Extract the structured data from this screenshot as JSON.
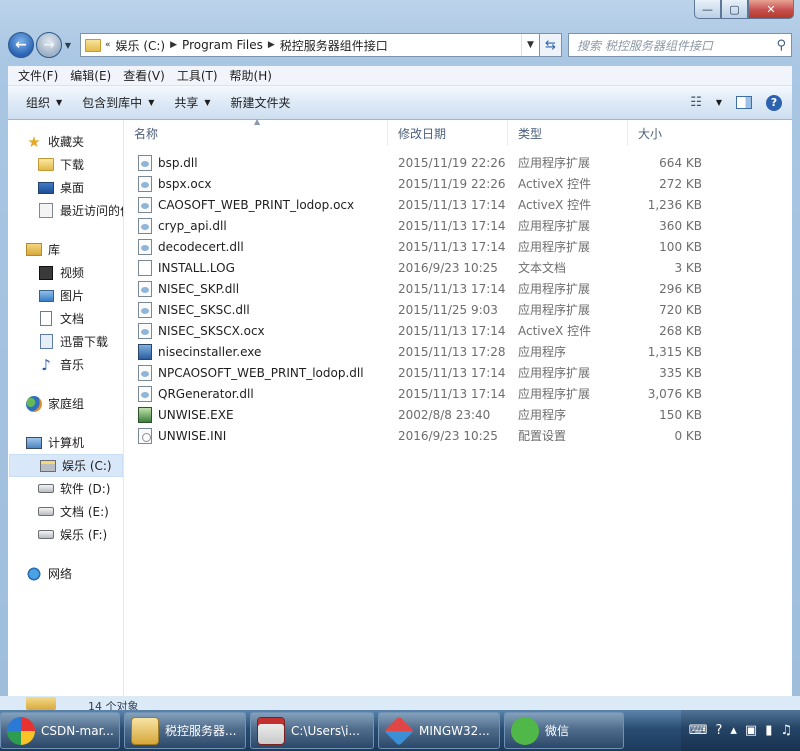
{
  "window": {
    "caption_buttons": [
      "—",
      "▢",
      "✕"
    ]
  },
  "address": {
    "overflow": "«",
    "crumbs": [
      "娱乐 (C:)",
      "Program Files",
      "税控服务器组件接口"
    ],
    "search_placeholder": "搜索 税控服务器组件接口"
  },
  "menubar": [
    "文件(F)",
    "编辑(E)",
    "查看(V)",
    "工具(T)",
    "帮助(H)"
  ],
  "commandbar": {
    "organize": "组织",
    "include_library": "包含到库中",
    "share": "共享",
    "new_folder": "新建文件夹"
  },
  "navpane": {
    "favorites": {
      "label": "收藏夹",
      "items": [
        "下载",
        "桌面",
        "最近访问的位置"
      ]
    },
    "libraries": {
      "label": "库",
      "items": [
        "视频",
        "图片",
        "文档",
        "迅雷下载",
        "音乐"
      ]
    },
    "homegroup": "家庭组",
    "computer": {
      "label": "计算机",
      "items": [
        "娱乐 (C:)",
        "软件 (D:)",
        "文档 (E:)",
        "娱乐 (F:)"
      ]
    },
    "network": "网络"
  },
  "columns": {
    "name": "名称",
    "date": "修改日期",
    "type": "类型",
    "size": "大小"
  },
  "files": [
    {
      "name": "bsp.dll",
      "date": "2015/11/19 22:26",
      "type": "应用程序扩展",
      "size": "664 KB",
      "icon": "dll-icon"
    },
    {
      "name": "bspx.ocx",
      "date": "2015/11/19 22:26",
      "type": "ActiveX 控件",
      "size": "272 KB",
      "icon": "ocx-icon"
    },
    {
      "name": "CAOSOFT_WEB_PRINT_lodop.ocx",
      "date": "2015/11/13 17:14",
      "type": "ActiveX 控件",
      "size": "1,236 KB",
      "icon": "ocx-icon"
    },
    {
      "name": "cryp_api.dll",
      "date": "2015/11/13 17:14",
      "type": "应用程序扩展",
      "size": "360 KB",
      "icon": "dll-icon"
    },
    {
      "name": "decodecert.dll",
      "date": "2015/11/13 17:14",
      "type": "应用程序扩展",
      "size": "100 KB",
      "icon": "dll-icon"
    },
    {
      "name": "INSTALL.LOG",
      "date": "2016/9/23 10:25",
      "type": "文本文档",
      "size": "3 KB",
      "icon": "text-file-icon"
    },
    {
      "name": "NISEC_SKP.dll",
      "date": "2015/11/13 17:14",
      "type": "应用程序扩展",
      "size": "296 KB",
      "icon": "dll-icon"
    },
    {
      "name": "NISEC_SKSC.dll",
      "date": "2015/11/25 9:03",
      "type": "应用程序扩展",
      "size": "720 KB",
      "icon": "dll-icon"
    },
    {
      "name": "NISEC_SKSCX.ocx",
      "date": "2015/11/13 17:14",
      "type": "ActiveX 控件",
      "size": "268 KB",
      "icon": "ocx-icon"
    },
    {
      "name": "nisecinstaller.exe",
      "date": "2015/11/13 17:28",
      "type": "应用程序",
      "size": "1,315 KB",
      "icon": "exe-icon"
    },
    {
      "name": "NPCAOSOFT_WEB_PRINT_lodop.dll",
      "date": "2015/11/13 17:14",
      "type": "应用程序扩展",
      "size": "335 KB",
      "icon": "dll-icon"
    },
    {
      "name": "QRGenerator.dll",
      "date": "2015/11/13 17:14",
      "type": "应用程序扩展",
      "size": "3,076 KB",
      "icon": "dll-icon"
    },
    {
      "name": "UNWISE.EXE",
      "date": "2002/8/8 23:40",
      "type": "应用程序",
      "size": "150 KB",
      "icon": "exe-icon"
    },
    {
      "name": "UNWISE.INI",
      "date": "2016/9/23 10:25",
      "type": "配置设置",
      "size": "0 KB",
      "icon": "ini-file-icon"
    }
  ],
  "status": {
    "text": "14 个对象"
  },
  "taskbar": {
    "buttons": [
      "CSDN-mar...",
      "税控服务器...",
      "C:\\Users\\i...",
      "MINGW32...",
      "微信"
    ]
  }
}
